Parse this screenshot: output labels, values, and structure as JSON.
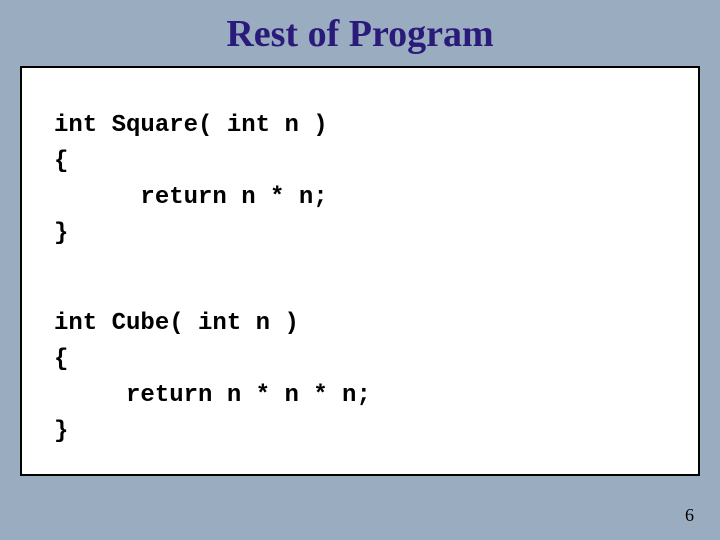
{
  "title": "Rest of Program",
  "code": {
    "line1": "int Square( int n )",
    "line2": "{",
    "line3": "      return n * n;",
    "line4": "}",
    "line5": "int Cube( int n )",
    "line6": "{",
    "line7": "     return n * n * n;",
    "line8": "}"
  },
  "page_number": "6"
}
